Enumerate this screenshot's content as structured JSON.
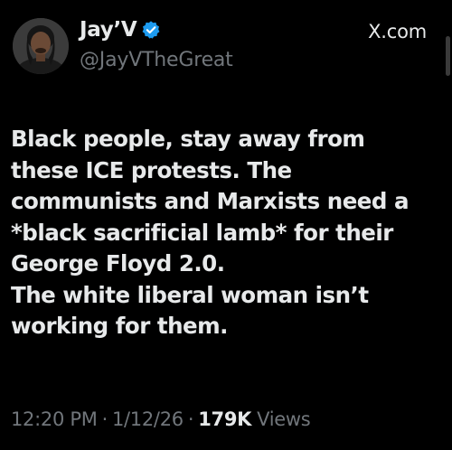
{
  "author": {
    "display_name": "Jay’V",
    "handle": "@JayVTheGreat",
    "verified": true,
    "verified_color": "#1d9bf0",
    "avatar_icon": "profile-photo"
  },
  "brand": {
    "label": "X.com",
    "icon": "x-logo-icon"
  },
  "tweet": {
    "lines": [
      "Black people, stay away from",
      "these ICE protests. The",
      "communists and Marxists need a",
      "*black sacrificial lamb* for their",
      "George Floyd 2.0.",
      "The white liberal woman isn’t",
      "working for them."
    ]
  },
  "meta": {
    "time": "12:20 PM",
    "separator": "·",
    "date": "1/12/26",
    "view_count": "179K",
    "views_label": "Views"
  },
  "colors": {
    "background": "#000000",
    "primary_text": "#e7e9ea",
    "secondary_text": "#71767b"
  }
}
